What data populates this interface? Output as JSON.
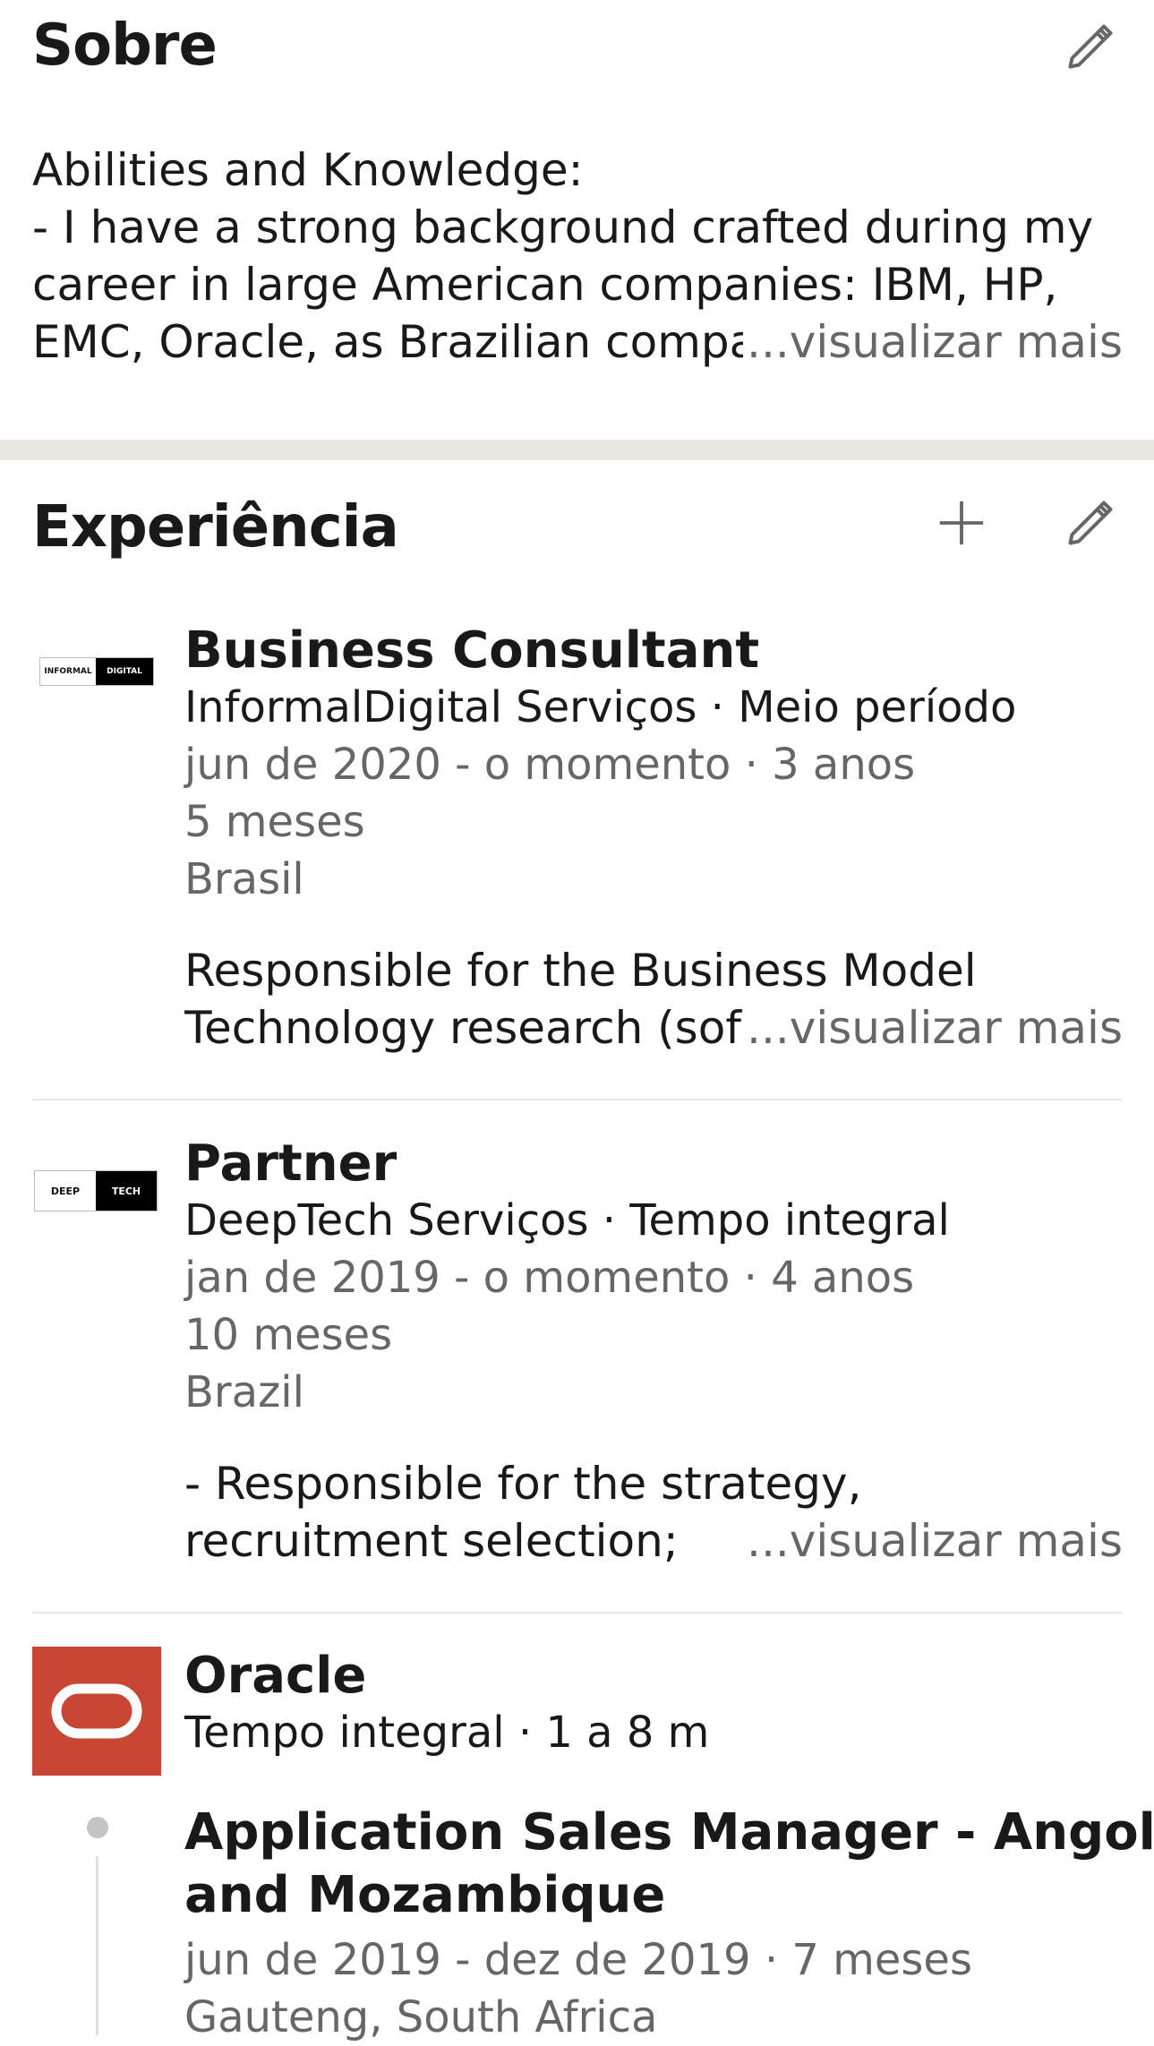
{
  "about": {
    "title": "Sobre",
    "lines": [
      "Abilities and Knowledge:",
      "- I have a strong background crafted during my",
      "career in large American companies: IBM, HP,",
      "EMC, Oracle, as Brazilian compa"
    ],
    "see_more": "...visualizar mais",
    "edit_icon": "pencil-icon"
  },
  "experience": {
    "title": "Experiência",
    "add_icon": "plus-icon",
    "edit_icon": "pencil-icon",
    "items": [
      {
        "logo_text_left": "INFORMAL",
        "logo_text_right": "DIGITAL",
        "title": "Business Consultant",
        "company": "InformalDigital Serviços · Meio período",
        "dates": "jun de 2020 - o momento · 3 anos",
        "duration_extra": "5 meses",
        "location": "Brasil",
        "desc_line1": "Responsible for the Business Model",
        "desc_line2": "Technology research (sof",
        "see_more": "...visualizar mais"
      },
      {
        "logo_text_left": "DEEP",
        "logo_text_right": "TECH",
        "title": "Partner",
        "company": "DeepTech Serviços · Tempo integral",
        "dates": "jan de 2019 - o momento · 4 anos",
        "duration_extra": "10 meses",
        "location": "Brazil",
        "desc_line1": "- Responsible for the strategy,",
        "desc_line2": "recruitment selection;",
        "see_more": "...visualizar mais"
      },
      {
        "title": "Oracle",
        "company": "Tempo integral · 1 a 8 m",
        "brand_color": "#c74634",
        "role": {
          "title_line1": "Application Sales Manager - Angola",
          "title_line2": "and Mozambique",
          "dates": "jun de 2019 - dez de 2019 · 7 meses",
          "location": "Gauteng, South Africa"
        }
      }
    ]
  }
}
